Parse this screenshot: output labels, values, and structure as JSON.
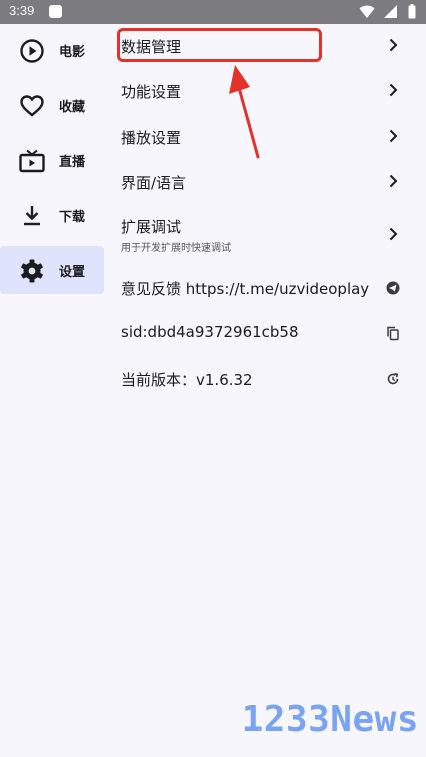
{
  "status_bar": {
    "time": "3:39",
    "icons": [
      "notification-square-icon",
      "wifi-icon",
      "signal-icon",
      "battery-icon"
    ]
  },
  "nav": {
    "items": [
      {
        "label": "电影",
        "icon": "play-circle-icon",
        "active": false
      },
      {
        "label": "收藏",
        "icon": "heart-icon",
        "active": false
      },
      {
        "label": "直播",
        "icon": "tv-icon",
        "active": false
      },
      {
        "label": "下载",
        "icon": "download-icon",
        "active": false
      },
      {
        "label": "设置",
        "icon": "gear-icon",
        "active": true
      }
    ],
    "active_bg": "#dfe4fc"
  },
  "settings": {
    "items": [
      {
        "label": "数据管理",
        "trailing": "chevron-right-icon",
        "highlighted": true
      },
      {
        "label": "功能设置",
        "trailing": "chevron-right-icon"
      },
      {
        "label": "播放设置",
        "trailing": "chevron-right-icon"
      },
      {
        "label": "界面/语言",
        "trailing": "chevron-right-icon"
      },
      {
        "label": "扩展调试",
        "sublabel": "用于开发扩展时快速调试",
        "trailing": "chevron-right-icon"
      },
      {
        "label": "意见反馈 https://t.me/uzvideoplay",
        "trailing": "telegram-icon"
      },
      {
        "label": "sid:dbd4a9372961cb58",
        "trailing": "copy-icon"
      },
      {
        "label": "当前版本：v1.6.32",
        "trailing": "update-icon"
      }
    ]
  },
  "annotation": {
    "color": "#e2322a"
  },
  "watermark": {
    "text": "1233News",
    "color": "#7aa3f2"
  }
}
